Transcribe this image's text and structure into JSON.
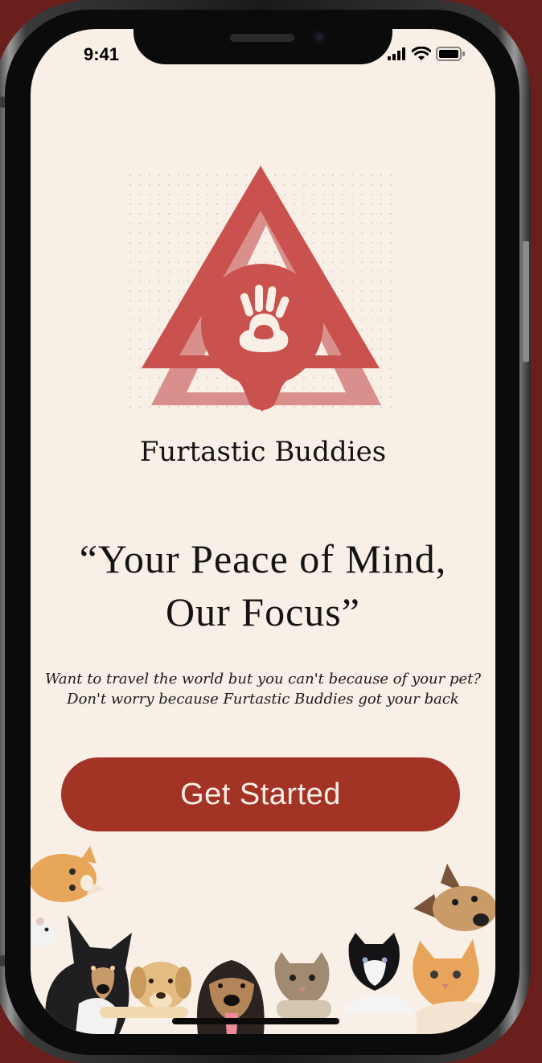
{
  "status_bar": {
    "time": "9:41",
    "icons": [
      "signal-icon",
      "wifi-icon",
      "battery-icon"
    ]
  },
  "logo": {
    "icon": "paw-pin-icon",
    "colors": {
      "primary": "#c9524e",
      "shadow": "#d9908c"
    }
  },
  "brand": {
    "name": "Furtastic Buddies"
  },
  "tagline": {
    "line1": "“Your Peace of Mind,",
    "line2": "Our Focus”"
  },
  "description": {
    "line1": "Want to travel the world but you can't because of your pet?",
    "line2": "Don't worry because Furtastic Buddies got your back"
  },
  "cta": {
    "label": "Get Started",
    "color": "#a23325"
  },
  "illustration": {
    "icons": [
      "cat-icon",
      "hamster-icon",
      "dog-icon",
      "puppy-icon",
      "kitten-icon"
    ]
  },
  "colors": {
    "background": "#f8efe7",
    "frame": "#6b1f1d",
    "text": "#141414"
  }
}
